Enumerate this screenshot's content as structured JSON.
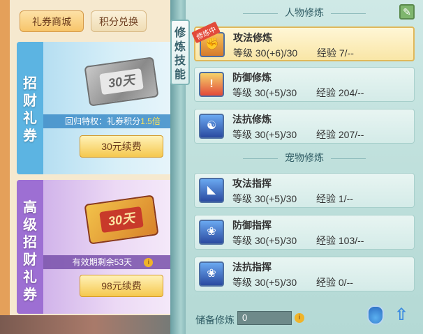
{
  "left": {
    "tabs": [
      {
        "label": "礼券商城",
        "active": true
      },
      {
        "label": "积分兑换",
        "active": false
      }
    ],
    "cards": [
      {
        "title": "招财礼券",
        "ticket_days": "30天",
        "info_prefix": "回归特权：礼券积分",
        "info_highlight": "1.5倍",
        "button": "30元续费"
      },
      {
        "title": "高级招财礼券",
        "ticket_days": "30天",
        "info_prefix": "有效期剩余53天",
        "info_highlight": "",
        "button": "98元续费"
      }
    ]
  },
  "tag": {
    "label": "修炼技能"
  },
  "right": {
    "person_title": "人物修炼",
    "pet_title": "宠物修炼",
    "person_skills": [
      {
        "name": "攻法修炼",
        "level": "等级 30(+6)/30",
        "exp": "经验 7/--",
        "selected": true,
        "badge": "修炼中",
        "icon": "attack-icon"
      },
      {
        "name": "防御修炼",
        "level": "等级 30(+5)/30",
        "exp": "经验 204/--",
        "selected": false,
        "icon": "defense-icon"
      },
      {
        "name": "法抗修炼",
        "level": "等级 30(+5)/30",
        "exp": "经验 207/--",
        "selected": false,
        "icon": "magic-resist-icon"
      }
    ],
    "pet_skills": [
      {
        "name": "攻法指挥",
        "level": "等级 30(+5)/30",
        "exp": "经验 1/--",
        "icon": "pet-attack-icon"
      },
      {
        "name": "防御指挥",
        "level": "等级 30(+5)/30",
        "exp": "经验 103/--",
        "icon": "pet-defense-icon"
      },
      {
        "name": "法抗指挥",
        "level": "等级 30(+5)/30",
        "exp": "经验 0/--",
        "icon": "pet-resist-icon"
      }
    ],
    "reserve_label": "储备修炼",
    "reserve_value": "0"
  }
}
